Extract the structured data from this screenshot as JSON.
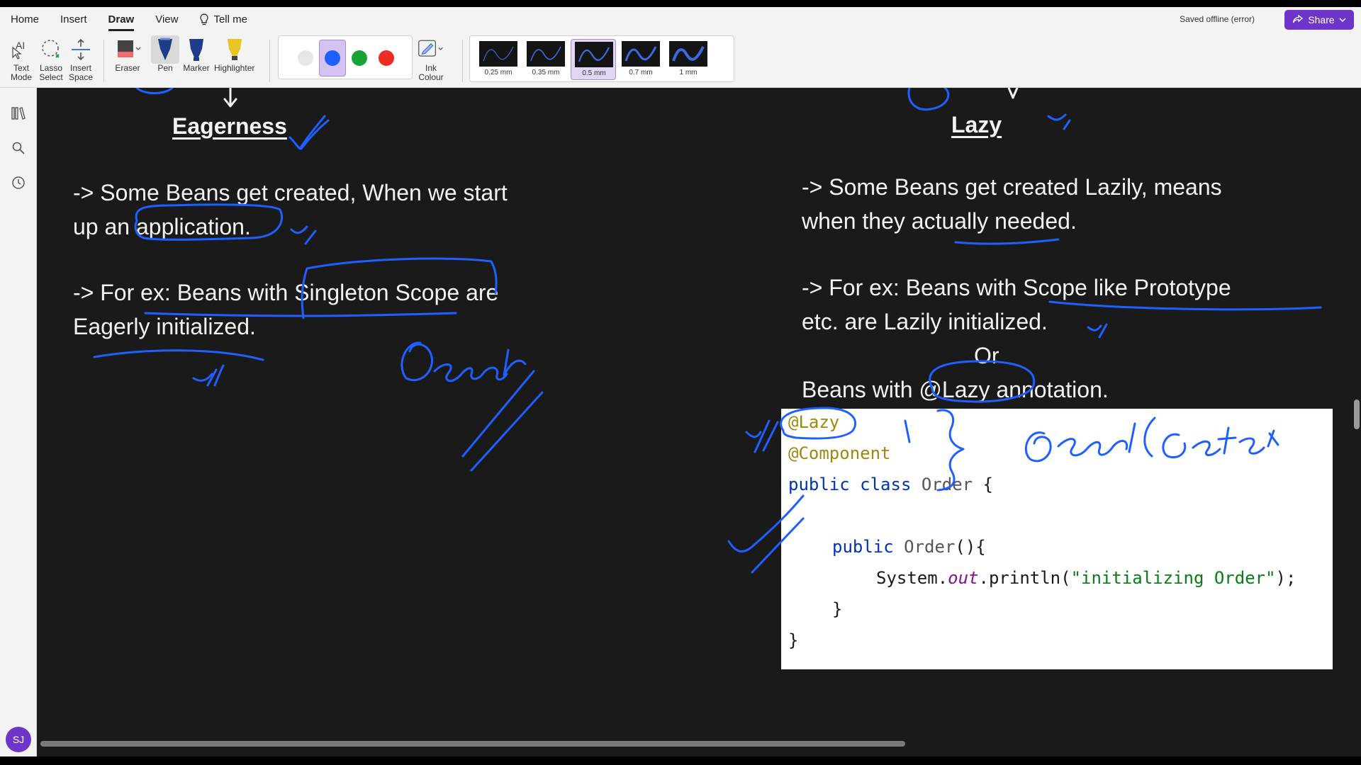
{
  "menu": {
    "tabs": [
      {
        "label": "Home"
      },
      {
        "label": "Insert"
      },
      {
        "label": "Draw"
      },
      {
        "label": "View"
      }
    ],
    "tell_me": "Tell me",
    "saved_status": "Saved offline (error)",
    "share_label": "Share"
  },
  "toolbar": {
    "text_mode": [
      "Text",
      "Mode"
    ],
    "lasso": [
      "Lasso",
      "Select"
    ],
    "insert_space": [
      "Insert",
      "Space"
    ],
    "eraser": "Eraser",
    "pen": "Pen",
    "marker": "Marker",
    "highlighter": "Highlighter",
    "ink_colour": [
      "Ink",
      "Colour"
    ],
    "colors": [
      "#e6e6e6",
      "#1f5fff",
      "#19a336",
      "#ef2b24"
    ],
    "selected_color": "#1f5fff",
    "thickness": [
      "0.25 mm",
      "0.35 mm",
      "0.5 mm",
      "0.7 mm",
      "1 mm"
    ],
    "selected_thickness": "0.5 mm"
  },
  "user": {
    "initials": "SJ"
  },
  "notes": {
    "left": {
      "heading": "Eagerness",
      "p1_l1": "-> Some Beans get created, When we start",
      "p1_l2": "up an application.",
      "p2_l1": "-> For ex: Beans with Singleton Scope are",
      "p2_l2": "Eagerly initialized."
    },
    "right": {
      "heading": "Lazy",
      "p1_l1": "-> Some Beans get created Lazily, means",
      "p1_l2": "when they actually needed.",
      "p2_l1": "-> For ex: Beans with Scope like Prototype",
      "p2_l2": "etc. are Lazily initialized.",
      "or": "Or",
      "p3": "Beans with @Lazy annotation."
    }
  },
  "code": {
    "l1": "@Lazy",
    "l2": "@Component",
    "l3_kw": "public class ",
    "l3_cls": "Order",
    "l3_end": " {",
    "l5_kw": "public ",
    "l5_cls": "Order",
    "l5_end": "(){",
    "l6_a": "System.",
    "l6_b": "out",
    "l6_c": ".println(",
    "l6_d": "\"initializing Order\"",
    "l6_e": ");",
    "l7": "}",
    "l8": "}"
  },
  "ink_color": "#1f5fff"
}
